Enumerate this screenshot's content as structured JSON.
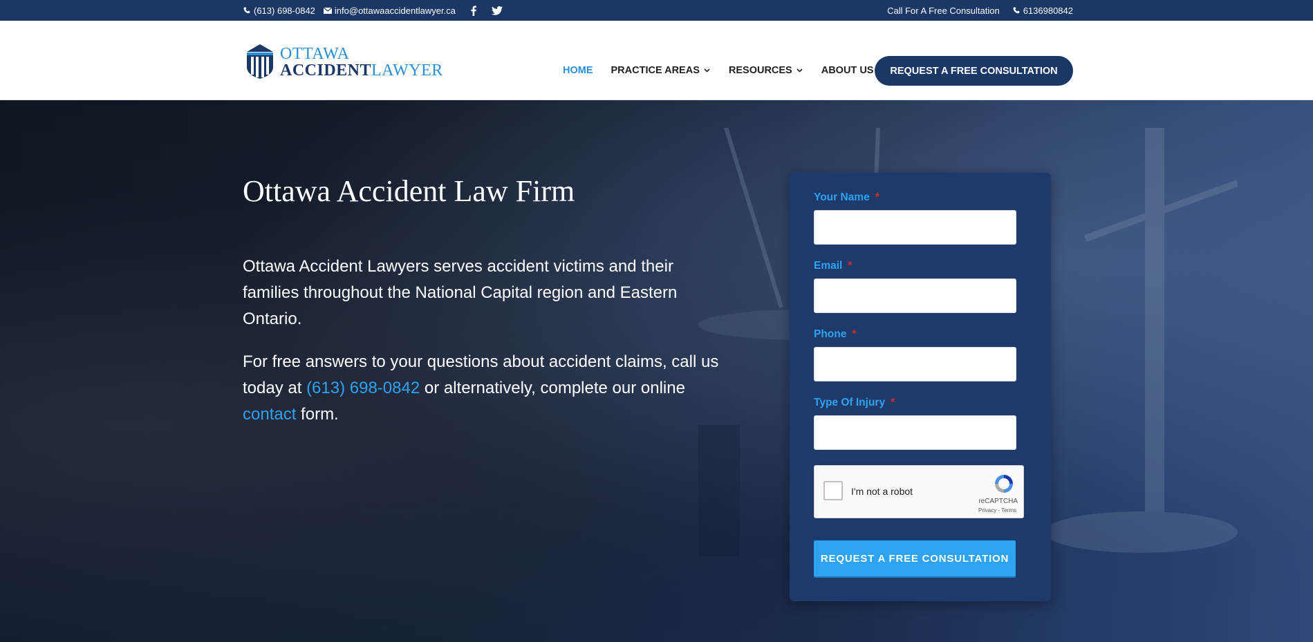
{
  "topbar": {
    "phone": "(613) 698-0842",
    "email": "info@ottawaaccidentlawyer.ca",
    "cta_text": "Call For A Free Consultation",
    "phone_alt": "6136980842",
    "social": [
      "facebook-icon",
      "twitter-icon"
    ]
  },
  "logo": {
    "line1": "OTTAWA",
    "line2a": "ACCIDENT",
    "line2b": "LAWYER"
  },
  "nav": {
    "items": [
      {
        "label": "HOME",
        "active": true
      },
      {
        "label": "PRACTICE AREAS",
        "dropdown": true
      },
      {
        "label": "RESOURCES",
        "dropdown": true
      },
      {
        "label": "ABOUT US"
      }
    ],
    "cta": "REQUEST A FREE CONSULTATION"
  },
  "hero": {
    "title": "Ottawa Accident Law Firm",
    "p1": "Ottawa Accident Lawyers serves accident victims and their families throughout the National Capital region and Eastern Ontario.",
    "p2_a": "For free answers to your questions about accident claims, call us today at ",
    "p2_phone": "(613) 698-0842",
    "p2_b": " or alternatively, complete our online ",
    "p2_link": "contact",
    "p2_c": " form."
  },
  "form": {
    "fields": [
      {
        "label": "Your Name",
        "required_mark": "*"
      },
      {
        "label": "Email",
        "required_mark": "*"
      },
      {
        "label": "Phone",
        "required_mark": "*"
      },
      {
        "label": "Type Of Injury",
        "required_mark": "*"
      }
    ],
    "captcha": {
      "label": "I'm not a robot",
      "brand": "reCAPTCHA",
      "terms": "Privacy - Terms"
    },
    "submit": "REQUEST A FREE CONSULTATION"
  },
  "colors": {
    "navy": "#1b3766",
    "accent": "#2ea3f2",
    "required": "#e02b20",
    "form_bg": "#1e3a6b"
  }
}
